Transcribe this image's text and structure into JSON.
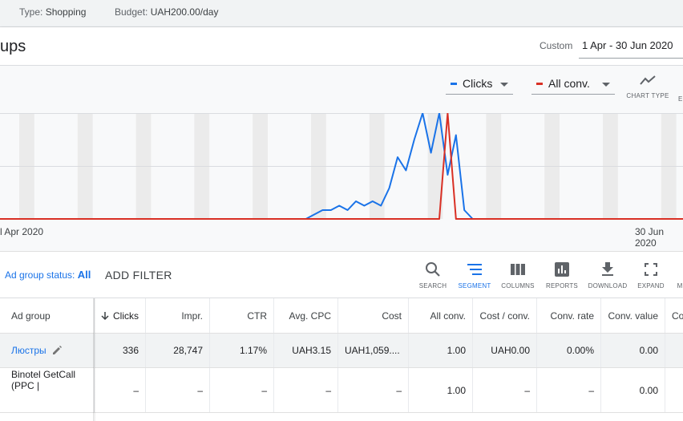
{
  "top_bar": {
    "type_label": "Type:",
    "type_value": "Shopping",
    "budget_label": "Budget:",
    "budget_value": "UAH200.00/day"
  },
  "title_bar": {
    "page_title": "ups",
    "date_range_label": "Custom",
    "date_range_value": "1 Apr - 30 Jun 2020"
  },
  "chart": {
    "metric_1": "Clicks",
    "metric_2": "All conv.",
    "chart_type_label": "CHART TYPE",
    "x_start_label": "l Apr 2020",
    "x_end_label": "30 Jun 2020",
    "colors": {
      "clicks": "#1a73e8",
      "all_conv": "#d93025"
    }
  },
  "chart_data": {
    "type": "line",
    "x_range": [
      "1 Apr 2020",
      "30 Jun 2020"
    ],
    "series": [
      {
        "name": "Clicks",
        "values": [
          0,
          0,
          0,
          0,
          0,
          0,
          0,
          0,
          0,
          0,
          0,
          0,
          0,
          0,
          0,
          0,
          0,
          0,
          0,
          0,
          0,
          0,
          0,
          0,
          0,
          0,
          0,
          0,
          0,
          0,
          0,
          0,
          0,
          0,
          0,
          0,
          0,
          0,
          0,
          0,
          1,
          2,
          2,
          3,
          2,
          4,
          3,
          4,
          3,
          7,
          14,
          11,
          18,
          24,
          15,
          24,
          10,
          19,
          2,
          0,
          0,
          0,
          0,
          0,
          0,
          0,
          0,
          0,
          0,
          0,
          0,
          0,
          0,
          0,
          0,
          0,
          0,
          0,
          0,
          0,
          0,
          0,
          0,
          0,
          0,
          0,
          0,
          0,
          0,
          0,
          0
        ]
      },
      {
        "name": "All conv.",
        "values": [
          0,
          0,
          0,
          0,
          0,
          0,
          0,
          0,
          0,
          0,
          0,
          0,
          0,
          0,
          0,
          0,
          0,
          0,
          0,
          0,
          0,
          0,
          0,
          0,
          0,
          0,
          0,
          0,
          0,
          0,
          0,
          0,
          0,
          0,
          0,
          0,
          0,
          0,
          0,
          0,
          0,
          0,
          0,
          0,
          0,
          0,
          0,
          0,
          0,
          0,
          0,
          0,
          0,
          0,
          0,
          0,
          1,
          0,
          0,
          0,
          0,
          0,
          0,
          0,
          0,
          0,
          0,
          0,
          0,
          0,
          0,
          0,
          0,
          0,
          0,
          0,
          0,
          0,
          0,
          0,
          0,
          0,
          0,
          0,
          0,
          0,
          0,
          0,
          0,
          0,
          0
        ]
      }
    ],
    "grid": true
  },
  "toolbar": {
    "status_label": "Ad group status:",
    "status_value": "All",
    "add_filter": "ADD FILTER",
    "tools": [
      {
        "label": "SEARCH",
        "icon": "search-icon"
      },
      {
        "label": "SEGMENT",
        "icon": "segment-icon"
      },
      {
        "label": "COLUMNS",
        "icon": "columns-icon"
      },
      {
        "label": "REPORTS",
        "icon": "reports-icon"
      },
      {
        "label": "DOWNLOAD",
        "icon": "download-icon"
      },
      {
        "label": "EXPAND",
        "icon": "expand-icon"
      }
    ]
  },
  "table": {
    "headers": [
      "Ad group",
      "Clicks",
      "Impr.",
      "CTR",
      "Avg. CPC",
      "Cost",
      "All conv.",
      "Cost / conv.",
      "Conv. rate",
      "Conv. value",
      "Co"
    ],
    "rows": [
      [
        "Люстры",
        "336",
        "28,747",
        "1.17%",
        "UAH3.15",
        "UAH1,059....",
        "1.00",
        "UAH0.00",
        "0.00%",
        "0.00",
        ""
      ],
      [
        "Binotel GetCall (PPC |",
        "–",
        "–",
        "–",
        "–",
        "–",
        "1.00",
        "–",
        "–",
        "0.00",
        ""
      ]
    ]
  }
}
